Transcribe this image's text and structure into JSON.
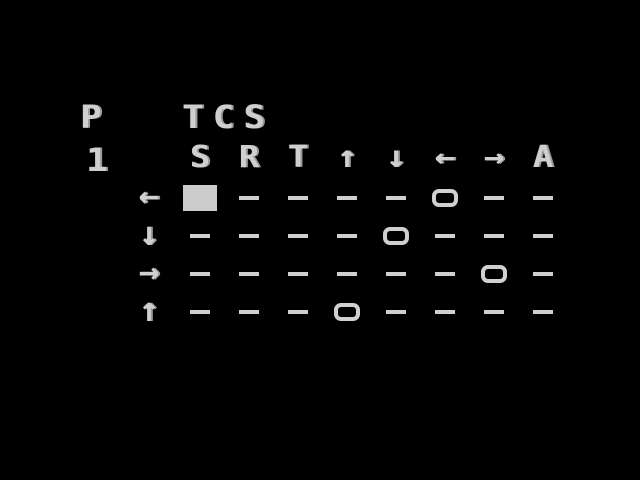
{
  "header": {
    "p_label": "P",
    "tcs_label": "TCS",
    "player_number": "1"
  },
  "columns": [
    "S",
    "R",
    "T",
    "↑",
    "↓",
    "←",
    "→",
    "A"
  ],
  "rows": [
    {
      "direction": "←",
      "selected_column": 5,
      "cursor_column": 0
    },
    {
      "direction": "↓",
      "selected_column": 4,
      "cursor_column": null
    },
    {
      "direction": "→",
      "selected_column": 6,
      "cursor_column": null
    },
    {
      "direction": "↑",
      "selected_column": 3,
      "cursor_column": null
    }
  ],
  "colors": {
    "background": "#000000",
    "foreground": "#cccccc"
  }
}
